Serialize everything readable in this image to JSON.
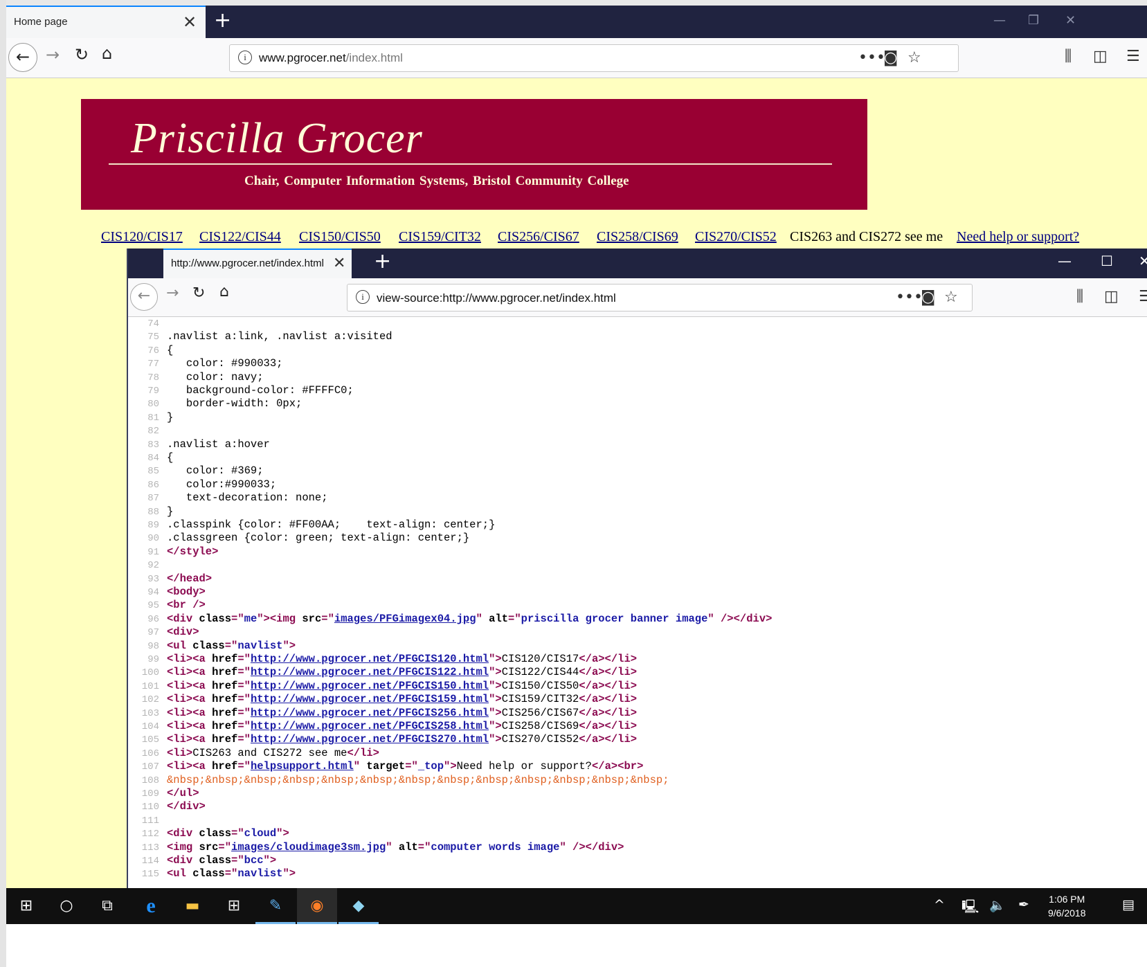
{
  "browser1": {
    "tab_title": "Home page",
    "tab_close": "✕",
    "new_tab": "+",
    "url_domain": "www.pgrocer.net",
    "url_path": "/index.html",
    "info_icon": "i",
    "minimize": "—",
    "restore": "❐",
    "close": "✕"
  },
  "page": {
    "banner_name": "Priscilla Grocer",
    "banner_subtitle": "Chair,  Computer Information Systems,  Bristol Community College",
    "nav_links": [
      "CIS120/CIS17",
      "CIS122/CIS44",
      "CIS150/CIS50",
      "CIS159/CIT32",
      "CIS256/CIS67",
      "CIS258/CIS69",
      "CIS270/CIS52"
    ],
    "nav_plain": "CIS263 and CIS272 see me",
    "nav_help": "Need help or support?"
  },
  "browser2": {
    "tab_title": "http://www.pgrocer.net/index.html",
    "tab_close": "✕",
    "new_tab": "+",
    "url": "view-source:http://www.pgrocer.net/index.html",
    "info_icon": "i",
    "minimize": "—",
    "maximize": "☐",
    "close": "✕"
  },
  "source_lines": [
    {
      "n": "74",
      "html": ""
    },
    {
      "n": "75",
      "html": ".navlist a:link, .navlist a:visited"
    },
    {
      "n": "76",
      "html": "{"
    },
    {
      "n": "77",
      "html": "   color: #990033;"
    },
    {
      "n": "78",
      "html": "   color: navy;"
    },
    {
      "n": "79",
      "html": "   background-color: #FFFFC0;"
    },
    {
      "n": "80",
      "html": "   border-width: 0px;"
    },
    {
      "n": "81",
      "html": "}"
    },
    {
      "n": "82",
      "html": ""
    },
    {
      "n": "83",
      "html": ".navlist a:hover"
    },
    {
      "n": "84",
      "html": "{"
    },
    {
      "n": "85",
      "html": "   color: #369;"
    },
    {
      "n": "86",
      "html": "   color:#990033;"
    },
    {
      "n": "87",
      "html": "   text-decoration: none;"
    },
    {
      "n": "88",
      "html": "}"
    },
    {
      "n": "89",
      "html": ".classpink {color: #FF00AA;    text-align: center;}"
    },
    {
      "n": "90",
      "html": ".classgreen {color: green; text-align: center;}"
    },
    {
      "n": "91",
      "html": "<span class=\"tag\">&lt;/style&gt;</span>"
    },
    {
      "n": "92",
      "html": ""
    },
    {
      "n": "93",
      "html": "<span class=\"tag\">&lt;/head&gt;</span>"
    },
    {
      "n": "94",
      "html": "<span class=\"tag\">&lt;body&gt;</span>"
    },
    {
      "n": "95",
      "html": "<span class=\"tag\">&lt;br /&gt;</span>"
    },
    {
      "n": "96",
      "html": "<span class=\"tag\">&lt;div <span class=\"an\">class</span>=\"<span class=\"av\">me</span>\"&gt;&lt;img <span class=\"an\">src</span>=\"<span class=\"lnk\">images/PFGimagex04.jpg</span>\" <span class=\"an\">alt</span>=\"<span class=\"av\">priscilla grocer banner image</span>\" /&gt;&lt;/div&gt;</span>"
    },
    {
      "n": "97",
      "html": "<span class=\"tag\">&lt;div&gt;</span>"
    },
    {
      "n": "98",
      "html": "<span class=\"tag\">&lt;ul <span class=\"an\">class</span>=\"<span class=\"av\">navlist</span>\"&gt;</span>"
    },
    {
      "n": "99",
      "html": "<span class=\"tag\">&lt;li&gt;&lt;a <span class=\"an\">href</span>=\"<span class=\"lnk\">http://www.pgrocer.net/PFGCIS120.html</span>\"&gt;</span>CIS120/CIS17<span class=\"tag\">&lt;/a&gt;&lt;/li&gt;</span>"
    },
    {
      "n": "100",
      "html": "<span class=\"tag\">&lt;li&gt;&lt;a <span class=\"an\">href</span>=\"<span class=\"lnk\">http://www.pgrocer.net/PFGCIS122.html</span>\"&gt;</span>CIS122/CIS44<span class=\"tag\">&lt;/a&gt;&lt;/li&gt;</span>"
    },
    {
      "n": "101",
      "html": "<span class=\"tag\">&lt;li&gt;&lt;a <span class=\"an\">href</span>=\"<span class=\"lnk\">http://www.pgrocer.net/PFGCIS150.html</span>\"&gt;</span>CIS150/CIS50<span class=\"tag\">&lt;/a&gt;&lt;/li&gt;</span>"
    },
    {
      "n": "102",
      "html": "<span class=\"tag\">&lt;li&gt;&lt;a <span class=\"an\">href</span>=\"<span class=\"lnk\">http://www.pgrocer.net/PFGCIS159.html</span>\"&gt;</span>CIS159/CIT32<span class=\"tag\">&lt;/a&gt;&lt;/li&gt;</span>"
    },
    {
      "n": "103",
      "html": "<span class=\"tag\">&lt;li&gt;&lt;a <span class=\"an\">href</span>=\"<span class=\"lnk\">http://www.pgrocer.net/PFGCIS256.html</span>\"&gt;</span>CIS256/CIS67<span class=\"tag\">&lt;/a&gt;&lt;/li&gt;</span>"
    },
    {
      "n": "104",
      "html": "<span class=\"tag\">&lt;li&gt;&lt;a <span class=\"an\">href</span>=\"<span class=\"lnk\">http://www.pgrocer.net/PFGCIS258.html</span>\"&gt;</span>CIS258/CIS69<span class=\"tag\">&lt;/a&gt;&lt;/li&gt;</span>"
    },
    {
      "n": "105",
      "html": "<span class=\"tag\">&lt;li&gt;&lt;a <span class=\"an\">href</span>=\"<span class=\"lnk\">http://www.pgrocer.net/PFGCIS270.html</span>\"&gt;</span>CIS270/CIS52<span class=\"tag\">&lt;/a&gt;&lt;/li&gt;</span>"
    },
    {
      "n": "106",
      "html": "<span class=\"tag\">&lt;li&gt;</span>CIS263 and CIS272 see me<span class=\"tag\">&lt;/li&gt;</span>"
    },
    {
      "n": "107",
      "html": "<span class=\"tag\">&lt;li&gt;&lt;a <span class=\"an\">href</span>=\"<span class=\"lnk\">helpsupport.html</span>\" <span class=\"an\">target</span>=\"<span class=\"av\">_top</span>\"&gt;</span>Need help or support?<span class=\"tag\">&lt;/a&gt;&lt;br&gt;</span>"
    },
    {
      "n": "108",
      "html": "<span class=\"ent\">&amp;nbsp;&amp;nbsp;&amp;nbsp;&amp;nbsp;&amp;nbsp;&amp;nbsp;&amp;nbsp;&amp;nbsp;&amp;nbsp;&amp;nbsp;&amp;nbsp;&amp;nbsp;&amp;nbsp;</span>"
    },
    {
      "n": "109",
      "html": "<span class=\"tag\">&lt;/ul&gt;</span>"
    },
    {
      "n": "110",
      "html": "<span class=\"tag\">&lt;/div&gt;</span>"
    },
    {
      "n": "111",
      "html": ""
    },
    {
      "n": "112",
      "html": "<span class=\"tag\">&lt;div <span class=\"an\">class</span>=\"<span class=\"av\">cloud</span>\"&gt;</span>"
    },
    {
      "n": "113",
      "html": "<span class=\"tag\">&lt;img <span class=\"an\">src</span>=\"<span class=\"lnk\">images/cloudimage3sm.jpg</span>\" <span class=\"an\">alt</span>=\"<span class=\"av\">computer words image</span>\" /&gt;&lt;/div&gt;</span>"
    },
    {
      "n": "114",
      "html": "<span class=\"tag\">&lt;div <span class=\"an\">class</span>=\"<span class=\"av\">bcc</span>\"&gt;</span>"
    },
    {
      "n": "115",
      "html": "<span class=\"tag\">&lt;ul <span class=\"an\">class</span>=\"<span class=\"av\">navlist</span>\"&gt;</span>"
    }
  ],
  "taskbar": {
    "time": "1:06 PM",
    "date": "9/6/2018"
  }
}
